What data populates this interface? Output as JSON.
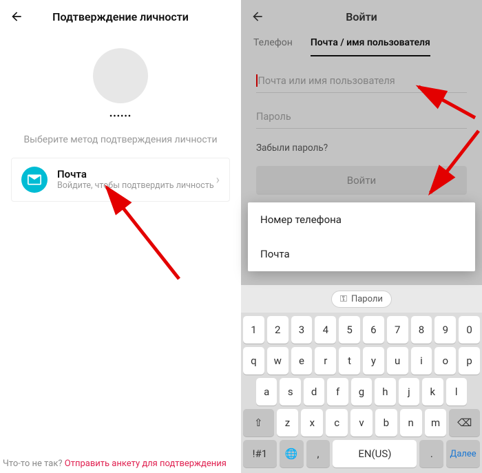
{
  "left": {
    "header_title": "Подтверждение личности",
    "masked": "••••••",
    "subtitle": "Выберите метод подтверждения личности",
    "method": {
      "title": "Почта",
      "subtitle": "Войдите, чтобы подтвердить личность"
    },
    "footer": {
      "question": "Что-то не так?",
      "link": "Отправить анкету для подтверждения"
    }
  },
  "right": {
    "header_title": "Войти",
    "tabs": {
      "phone": "Телефон",
      "email": "Почта / имя пользователя"
    },
    "email_placeholder": "Почта или имя пользователя",
    "password_placeholder": "Пароль",
    "forgot": "Забыли пароль?",
    "login_btn": "Войти",
    "popup": {
      "phone": "Номер телефона",
      "email": "Почта"
    },
    "chip": "Пароли",
    "keyboard": {
      "row1": [
        "1",
        "2",
        "3",
        "4",
        "5",
        "6",
        "7",
        "8",
        "9",
        "0"
      ],
      "row2": [
        "q",
        "w",
        "e",
        "r",
        "t",
        "y",
        "u",
        "i",
        "o",
        "p"
      ],
      "row3": [
        "a",
        "s",
        "d",
        "f",
        "g",
        "h",
        "j",
        "k",
        "l"
      ],
      "row4_shift": "⇧",
      "row4": [
        "z",
        "x",
        "c",
        "v",
        "b",
        "n",
        "m"
      ],
      "row4_bksp": "⌫",
      "row5": {
        "sym": "!#1",
        "globe": "🌐",
        "comma": ",",
        "lang": "EN(US)",
        "dot": ".",
        "next": "Далее"
      }
    }
  }
}
